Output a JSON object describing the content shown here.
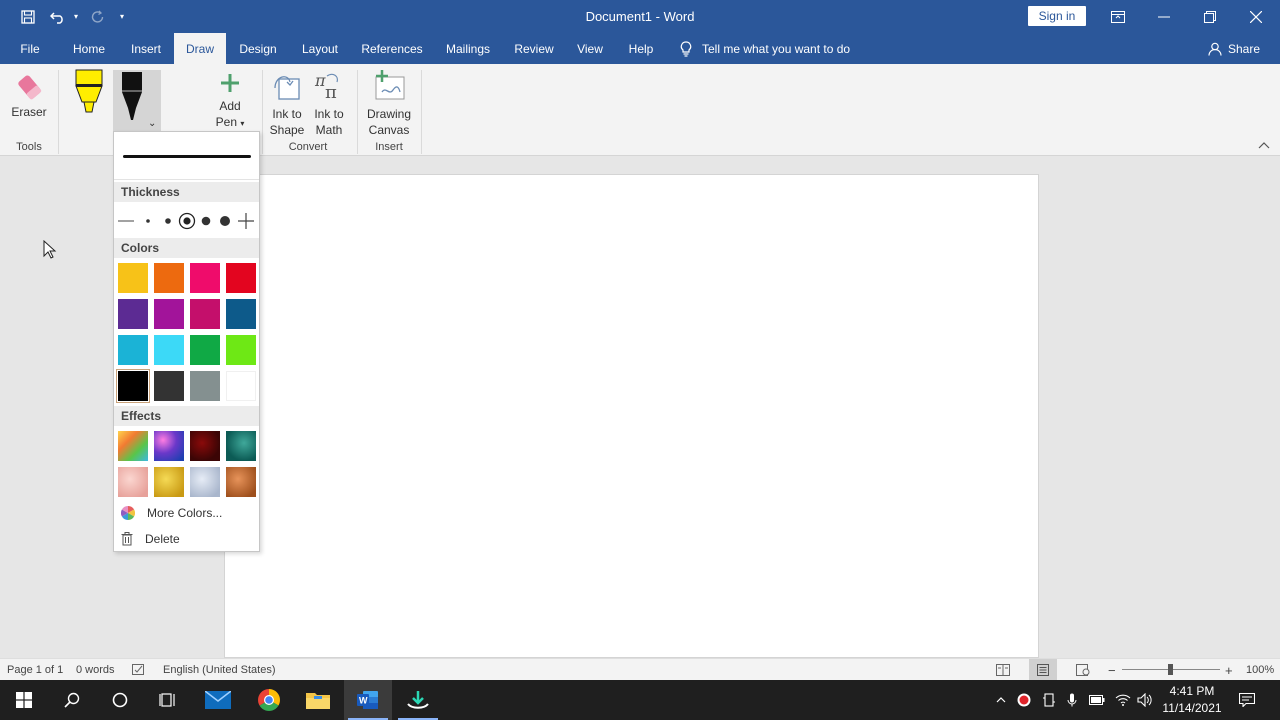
{
  "window": {
    "title": "Document1  -  Word",
    "signin_label": "Sign in"
  },
  "menu": {
    "tabs": [
      "File",
      "Home",
      "Insert",
      "Draw",
      "Design",
      "Layout",
      "References",
      "Mailings",
      "Review",
      "View",
      "Help"
    ],
    "active_tab": "Draw",
    "tell_me": "Tell me what you want to do",
    "share": "Share"
  },
  "ribbon": {
    "eraser": "Eraser",
    "add_pen_line1": "Add",
    "add_pen_line2": "Pen",
    "ink_to_shape_line1": "Ink to",
    "ink_to_shape_line2": "Shape",
    "ink_to_math_line1": "Ink to",
    "ink_to_math_line2": "Math",
    "drawing_canvas_line1": "Drawing",
    "drawing_canvas_line2": "Canvas",
    "groups": {
      "tools": "Tools",
      "convert": "Convert",
      "insert": "Insert"
    },
    "highlighter_color": "#ffee00",
    "pen_color": "#111111"
  },
  "pen_menu": {
    "thickness_header": "Thickness",
    "colors_header": "Colors",
    "effects_header": "Effects",
    "more_colors": "More Colors...",
    "delete": "Delete",
    "selected_thickness_index": 3,
    "selected_color": "#000000",
    "colors": [
      [
        "#f7c218",
        "#ed6a0f",
        "#ef0c6b",
        "#e3051f"
      ],
      [
        "#5c2b93",
        "#a2149a",
        "#c40f6b",
        "#0d5a8a"
      ],
      [
        "#1bb3d6",
        "#3cd9f7",
        "#10a945",
        "#6ee815"
      ],
      [
        "#000000",
        "#333333",
        "#849090",
        "#ffffff"
      ]
    ],
    "effects": [
      "rainbow",
      "galaxy",
      "lava",
      "ocean",
      "rose-gold",
      "gold",
      "silver",
      "bronze"
    ]
  },
  "status": {
    "page": "Page 1 of 1",
    "words": "0 words",
    "language": "English (United States)",
    "zoom": "100%"
  },
  "taskbar": {
    "time": "4:41 PM",
    "date": "11/14/2021"
  }
}
